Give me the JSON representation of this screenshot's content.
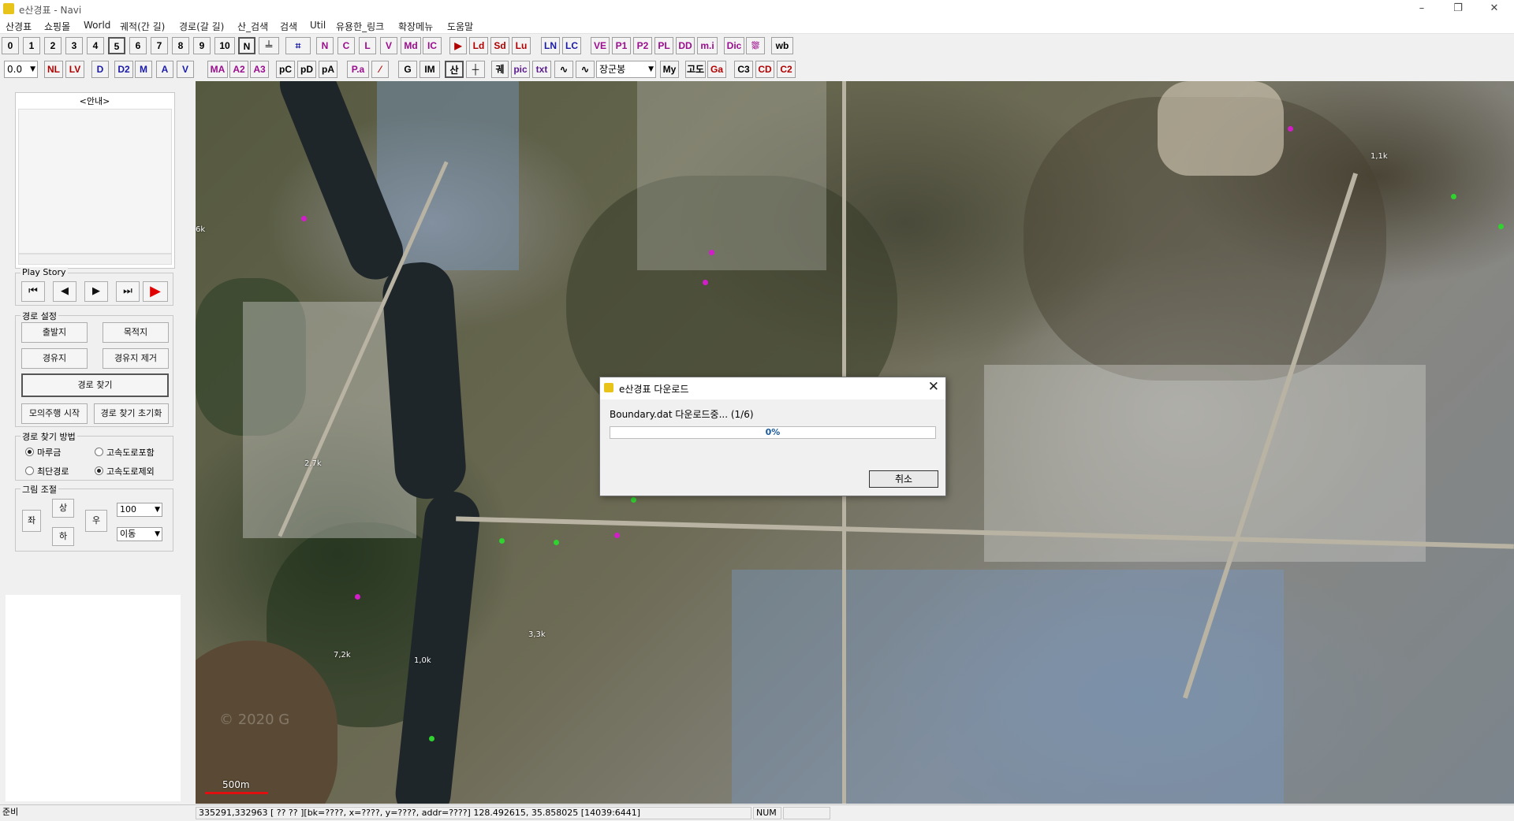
{
  "window": {
    "title": "e산경표 - Navi",
    "min_glyph": "–",
    "restore_glyph": "❐",
    "close_glyph": "✕"
  },
  "menu": [
    "산경표",
    "쇼핑몰",
    "World",
    "궤적(간 길)",
    "경로(갈 길)",
    "산_검색",
    "검색",
    "Util",
    "유용한_링크",
    "확장메뉴",
    "도움말"
  ],
  "toolbar1": [
    "0",
    "1",
    "2",
    "3",
    "4",
    "5",
    "6",
    "7",
    "8",
    "9",
    "10",
    "N",
    "╧",
    "⌗",
    "N",
    "C",
    "L",
    "V",
    "Md",
    "IC",
    "▶",
    "Ld",
    "Sd",
    "Lu",
    "LN",
    "LC",
    "VE",
    "P1",
    "P2",
    "PL",
    "DD",
    "m.i",
    "Dic",
    "⛆",
    "wb"
  ],
  "toolbar2": {
    "zoom_select": "0.0",
    "buttons": [
      "NL",
      "LV",
      "D",
      "D2",
      "M",
      "A",
      "V",
      "MA",
      "A2",
      "A3",
      "pC",
      "pD",
      "pA",
      "P.a",
      "⁄",
      "G",
      "IM",
      "산",
      "┼",
      "궤",
      "pic",
      "txt",
      "∿",
      "∿",
      "My",
      "고도",
      "Ga",
      "C3",
      "CD",
      "C2"
    ],
    "region_select": "장군봉"
  },
  "left_panel": {
    "guide_title": "<안내>",
    "play_story": {
      "label": "Play Story",
      "buttons": [
        "⏮",
        "◀",
        "▶",
        "⏭",
        "▶"
      ]
    },
    "route_setup": {
      "label": "경로 설정",
      "origin": "출발지",
      "destination": "목적지",
      "waypoint": "경유지",
      "remove_waypoint": "경유지 제거",
      "find_route": "경로 찾기",
      "simulate": "모의주행 시작",
      "reset": "경로 찾기 초기화"
    },
    "route_method": {
      "label": "경로 찾기 방법",
      "options": [
        {
          "label": "마루금",
          "checked": true
        },
        {
          "label": "고속도로포함",
          "checked": false
        },
        {
          "label": "최단경로",
          "checked": false
        },
        {
          "label": "고속도로제외",
          "checked": true
        }
      ]
    },
    "picture_adjust": {
      "label": "그림 조절",
      "left": "좌",
      "up": "상",
      "right": "우",
      "down": "하",
      "zoom_value": "100",
      "mode_value": "이동"
    }
  },
  "map": {
    "labels": [
      "1,1k",
      "6k",
      "2,7k",
      "7,2k",
      "1,0k",
      "3,3k"
    ],
    "scale_label": "500m",
    "watermark": "© 2020 G"
  },
  "dialog": {
    "title": "e산경표 다운로드",
    "message": "Boundary.dat 다운로드중... (1/6)",
    "progress_fraction": 0.0,
    "progress_text": "0%",
    "cancel": "취소"
  },
  "status_bar": {
    "ready": "준비",
    "coords": "335291,332963 [ ?? ?? ][bk=????, x=????, y=????, addr=????] 128.492615, 35.858025 [14039:6441]",
    "num": "NUM"
  },
  "colors": {
    "progress_fill": "#06b025",
    "scale_bar": "#e01010",
    "poi_magenta": "#d21ec8",
    "poi_green": "#2fd22f"
  }
}
